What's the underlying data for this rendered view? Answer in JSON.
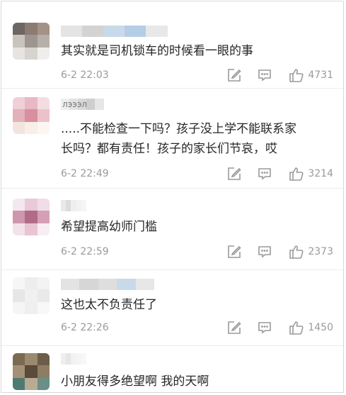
{
  "comments": [
    {
      "text": "其实就是司机锁车的时候看一眼的事",
      "time": "6-2 22:03",
      "likes": "4731",
      "avatar": [
        "#6e6660",
        "#8a7c72",
        "#a39285",
        "#c9c3be",
        "#9e9590",
        "#b6b0aa",
        "#e6e3e0",
        "#d7d3cf",
        "#efeeec"
      ],
      "name": [
        "#e4e4e4",
        "#d3d3d3",
        "#c8d9ea",
        "#b6cde6",
        "#e8e8e8"
      ]
    },
    {
      "text": ".....不能检查一下吗？孩子没上学不能联系家\n长吗？都有责任！孩子的家长们节哀，哎",
      "time": "6-2 22:49",
      "likes": "3214",
      "avatar": [
        "#f0cfd6",
        "#e8b9c4",
        "#f4dde1",
        "#e3b1bc",
        "#d88f9f",
        "#ebc2cb",
        "#f2e5e0",
        "#f7efe8",
        "#fbf6f2"
      ],
      "name": [
        "#eeeeee",
        "#e2e2e2",
        "#d9d9d9",
        "#cfcfcf",
        "#e6e6e6"
      ],
      "name_text": "лэээл"
    },
    {
      "text": "希望提高幼师门槛",
      "time": "6-2 22:59",
      "likes": "2373",
      "avatar": [
        "#f4e7ee",
        "#e9c9d8",
        "#f0dde6",
        "#cf97ae",
        "#b06c87",
        "#d59fb5",
        "#f3e2ea",
        "#e7c5d4",
        "#f7edf2"
      ],
      "name": [
        "#e9e9e9",
        "#dcdcdc",
        "#eeeeee",
        "#f2f2f2",
        "#f5f5f5"
      ]
    },
    {
      "text": "这也太不负责任了",
      "time": "6-2 22:26",
      "likes": "1450",
      "avatar": [
        "#f6f6f6",
        "#ededed",
        "#f3f3f3",
        "#e6e6e6",
        "#f0f0f0",
        "#e9e9e9",
        "#f5f5f5",
        "#efefef",
        "#f8f8f8"
      ],
      "name": [
        "#e3e3e3",
        "#d6d6d6",
        "#dedede",
        "#c8d9ea",
        "#e7e7e7"
      ]
    },
    {
      "text": "小朋友得多绝望啊 我的天啊",
      "time": "",
      "likes": "",
      "avatar": [
        "#7a6a52",
        "#9c8a6e",
        "#6d5d48",
        "#a49077",
        "#5a4a3a",
        "#8f7d63",
        "#4f7a72",
        "#b9aa93",
        "#6a8f86"
      ],
      "name": [
        "#eeeeee",
        "#e6e6e6",
        "#f2f2f2",
        "#f5f5f5",
        "#f7f7f7"
      ]
    }
  ],
  "icons": {
    "edit": "edit-icon",
    "reply": "comment-icon",
    "like": "thumbs-up-icon"
  },
  "colors": {
    "meta": "#9a9a9a",
    "icon": "#9a9a9a",
    "text": "#262626"
  }
}
